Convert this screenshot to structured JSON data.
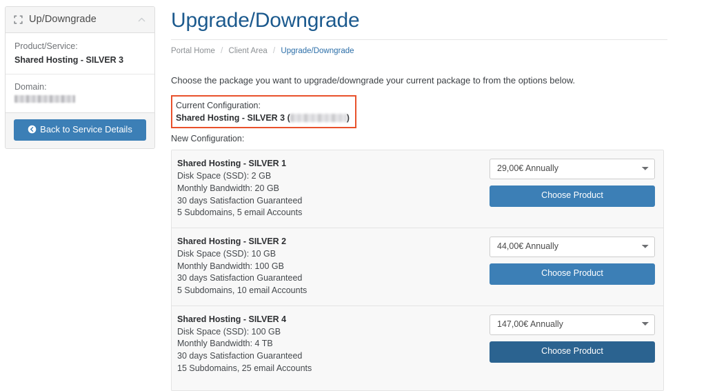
{
  "sidebar": {
    "panel_title": "Up/Downgrade",
    "header_icon": "expand-arrows-icon",
    "collapse_icon": "chevron-up-icon",
    "product_service_label": "Product/Service:",
    "product_service_value": "Shared Hosting - SILVER 3",
    "domain_label": "Domain:",
    "domain_value_redacted": true,
    "back_button": {
      "label": "Back to Service Details",
      "icon": "arrow-circle-left-icon"
    }
  },
  "main": {
    "page_title": "Upgrade/Downgrade",
    "breadcrumb": [
      {
        "label": "Portal Home",
        "active": false
      },
      {
        "label": "Client Area",
        "active": false
      },
      {
        "label": "Upgrade/Downgrade",
        "active": true
      }
    ],
    "breadcrumb_separator": "/",
    "intro_text": "Choose the package you want to upgrade/downgrade your current package to from the options below.",
    "current_configuration": {
      "label": "Current Configuration:",
      "value": "Shared Hosting - SILVER 3",
      "value_suffix_open": "(",
      "value_suffix_close": ")",
      "highlight_color": "#e8502a",
      "domain_redacted": true
    },
    "new_configuration_label": "New Configuration:",
    "products": [
      {
        "name": "Shared Hosting - SILVER 1",
        "features": [
          "Disk Space (SSD): 2 GB",
          "Monthly Bandwidth: 20 GB",
          "30 days Satisfaction Guaranteed",
          "5 Subdomains, 5 email Accounts"
        ],
        "price_selected": "29,00€ Annually",
        "price_options": [
          "29,00€ Annually"
        ],
        "choose_label": "Choose Product",
        "button_state": "normal"
      },
      {
        "name": "Shared Hosting - SILVER 2",
        "features": [
          "Disk Space (SSD): 10 GB",
          "Monthly Bandwidth: 100 GB",
          "30 days Satisfaction Guaranteed",
          "5 Subdomains, 10 email Accounts"
        ],
        "price_selected": "44,00€ Annually",
        "price_options": [
          "44,00€ Annually"
        ],
        "choose_label": "Choose Product",
        "button_state": "normal"
      },
      {
        "name": "Shared Hosting - SILVER 4",
        "features": [
          "Disk Space (SSD): 100 GB",
          "Monthly Bandwidth: 4 TB",
          "30 days Satisfaction Guaranteed",
          "15 Subdomains, 25 email Accounts"
        ],
        "price_selected": "147,00€ Annually",
        "price_options": [
          "147,00€ Annually"
        ],
        "choose_label": "Choose Product",
        "button_state": "active"
      }
    ]
  },
  "colors": {
    "primary_blue": "#3c7fb6",
    "primary_blue_active": "#2b6390",
    "title_blue": "#1c5a8e",
    "highlight_orange": "#e8502a"
  }
}
